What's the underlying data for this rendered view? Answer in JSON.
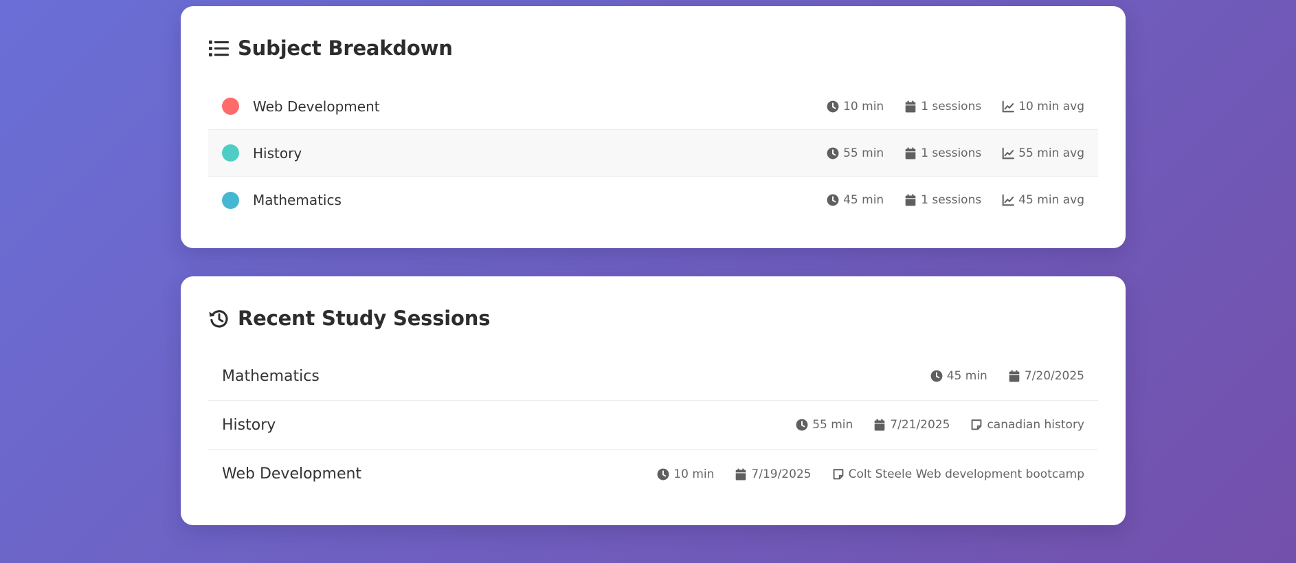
{
  "subject_breakdown": {
    "title": "Subject Breakdown",
    "title_icon": "list-icon",
    "items": [
      {
        "name": "Web Development",
        "color": "#ff6b6b",
        "time": "10 min",
        "sessions": "1 sessions",
        "avg": "10 min avg"
      },
      {
        "name": "History",
        "color": "#4ecdc4",
        "time": "55 min",
        "sessions": "1 sessions",
        "avg": "55 min avg"
      },
      {
        "name": "Mathematics",
        "color": "#45b7d1",
        "time": "45 min",
        "sessions": "1 sessions",
        "avg": "45 min avg"
      }
    ]
  },
  "recent_sessions": {
    "title": "Recent Study Sessions",
    "title_icon": "history-icon",
    "items": [
      {
        "subject": "Mathematics",
        "time": "45 min",
        "date": "7/20/2025"
      },
      {
        "subject": "History",
        "time": "55 min",
        "date": "7/21/2025",
        "note": "canadian history"
      },
      {
        "subject": "Web Development",
        "time": "10 min",
        "date": "7/19/2025",
        "note": "Colt Steele Web development bootcamp"
      }
    ]
  },
  "icons": {
    "time": "clock-icon",
    "sessions": "calendar-icon",
    "avg": "chart-line-icon",
    "note": "sticky-note-icon"
  },
  "colors": {
    "accent_start": "#6a6fd6",
    "accent_end": "#7350ab"
  }
}
